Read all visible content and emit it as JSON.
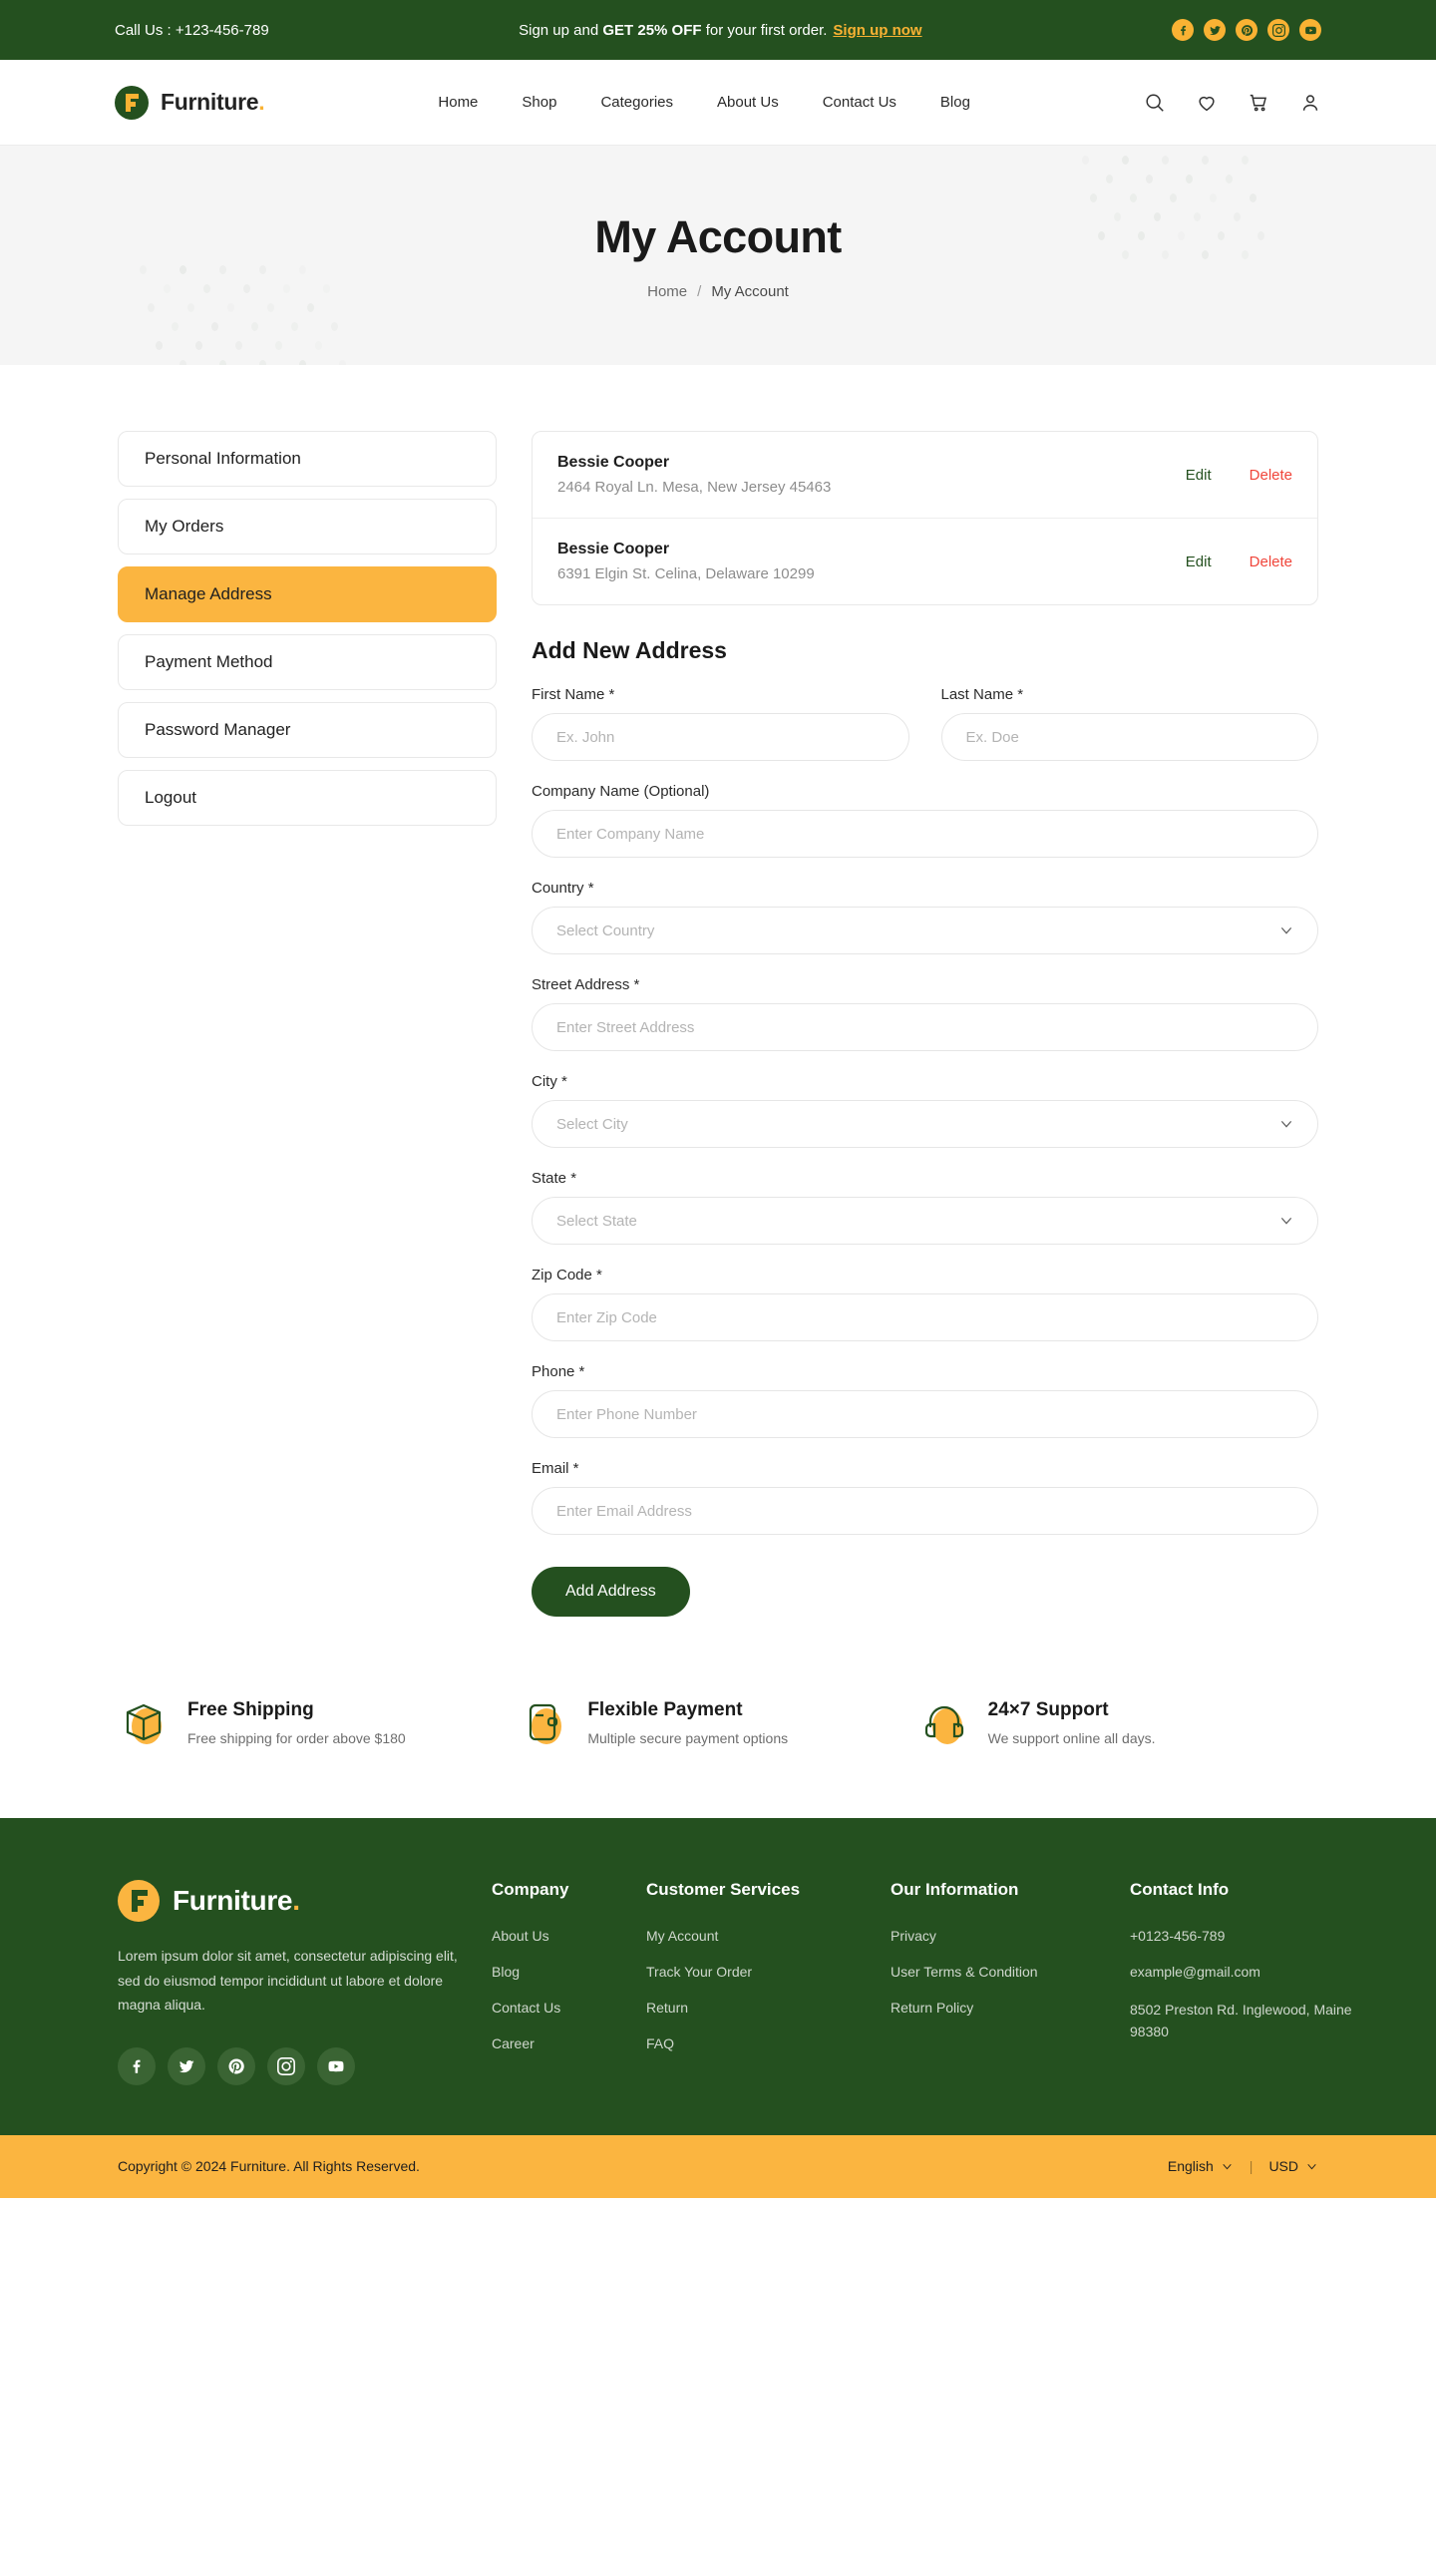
{
  "topbar": {
    "call_us": "Call Us :  +123-456-789",
    "promo_prefix": "Sign up and ",
    "promo_bold": "GET 25% OFF",
    "promo_suffix": " for your first order.",
    "promo_link": "Sign up now",
    "social": [
      {
        "name": "facebook-icon"
      },
      {
        "name": "twitter-icon"
      },
      {
        "name": "pinterest-icon"
      },
      {
        "name": "instagram-icon"
      },
      {
        "name": "youtube-icon"
      }
    ]
  },
  "header": {
    "brand": "Furniture",
    "brand_dot": ".",
    "nav": [
      {
        "label": "Home"
      },
      {
        "label": "Shop"
      },
      {
        "label": "Categories"
      },
      {
        "label": "About Us"
      },
      {
        "label": "Contact Us"
      },
      {
        "label": "Blog"
      }
    ],
    "icons": [
      "search-icon",
      "wishlist-heart-icon",
      "cart-icon",
      "account-user-icon"
    ]
  },
  "hero": {
    "title": "My Account",
    "breadcrumb_home": "Home",
    "breadcrumb_sep": "/",
    "breadcrumb_current": "My Account"
  },
  "sidebar": {
    "items": [
      {
        "label": "Personal Information",
        "active": false
      },
      {
        "label": "My Orders",
        "active": false
      },
      {
        "label": "Manage Address",
        "active": true
      },
      {
        "label": "Payment Method",
        "active": false
      },
      {
        "label": "Password Manager",
        "active": false
      },
      {
        "label": "Logout",
        "active": false
      }
    ]
  },
  "addresses": {
    "edit_label": "Edit",
    "delete_label": "Delete",
    "items": [
      {
        "name": "Bessie Cooper",
        "line": "2464 Royal Ln. Mesa, New Jersey 45463"
      },
      {
        "name": "Bessie Cooper",
        "line": "6391 Elgin St. Celina, Delaware 10299"
      }
    ]
  },
  "form": {
    "title": "Add New Address",
    "first_name_label": "First Name *",
    "first_name_placeholder": "Ex. John",
    "last_name_label": "Last Name *",
    "last_name_placeholder": "Ex. Doe",
    "company_label": "Company Name (Optional)",
    "company_placeholder": "Enter Company Name",
    "country_label": "Country *",
    "country_value": "Select Country",
    "street_label": "Street Address *",
    "street_placeholder": "Enter Street Address",
    "city_label": "City *",
    "city_value": "Select City",
    "state_label": "State *",
    "state_value": "Select State",
    "zip_label": "Zip Code *",
    "zip_placeholder": "Enter Zip Code",
    "phone_label": "Phone *",
    "phone_placeholder": "Enter Phone Number",
    "email_label": "Email *",
    "email_placeholder": "Enter Email Address",
    "submit_label": "Add Address"
  },
  "features": [
    {
      "icon": "package-box-icon",
      "title": "Free Shipping",
      "subtitle": "Free shipping for order above $180"
    },
    {
      "icon": "payment-card-icon",
      "title": "Flexible Payment",
      "subtitle": "Multiple secure payment options"
    },
    {
      "icon": "headset-support-icon",
      "title": "24×7 Support",
      "subtitle": "We support online all days."
    }
  ],
  "footer": {
    "brand": "Furniture",
    "brand_dot": ".",
    "description": "Lorem ipsum dolor sit amet, consectetur adipiscing elit, sed do eiusmod tempor incididunt ut labore et dolore magna aliqua.",
    "social": [
      {
        "name": "facebook-icon"
      },
      {
        "name": "twitter-icon"
      },
      {
        "name": "pinterest-icon"
      },
      {
        "name": "instagram-icon"
      },
      {
        "name": "youtube-icon"
      }
    ],
    "columns": {
      "company": {
        "head": "Company",
        "links": [
          "About Us",
          "Blog",
          "Contact Us",
          "Career"
        ]
      },
      "services": {
        "head": "Customer Services",
        "links": [
          "My Account",
          "Track Your Order",
          "Return",
          "FAQ"
        ]
      },
      "info": {
        "head": "Our Information",
        "links": [
          "Privacy",
          "User Terms & Condition",
          "Return Policy"
        ]
      },
      "contact": {
        "head": "Contact Info",
        "phone": "+0123-456-789",
        "email": "example@gmail.com",
        "address": "8502 Preston Rd. Inglewood, Maine 98380"
      }
    }
  },
  "copyright": {
    "text": "Copyright © 2024 Furniture. All Rights Reserved.",
    "language": "English",
    "divider": "|",
    "currency": "USD"
  }
}
